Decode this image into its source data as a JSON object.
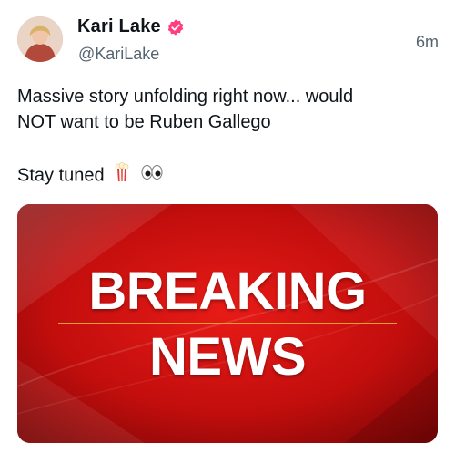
{
  "author": {
    "display_name": "Kari Lake",
    "handle": "@KariLake",
    "verified": true,
    "verified_color": "#ff3d7f"
  },
  "tweet": {
    "time_ago": "6m",
    "line1": "Massive story unfolding right now... would",
    "line2": "NOT want to be Ruben Gallego",
    "line3": "Stay tuned",
    "emojis": [
      "popcorn-icon",
      "eyes-icon"
    ]
  },
  "media": {
    "headline_top": "BREAKING",
    "headline_bottom": "NEWS",
    "background_color": "#c8100f"
  }
}
